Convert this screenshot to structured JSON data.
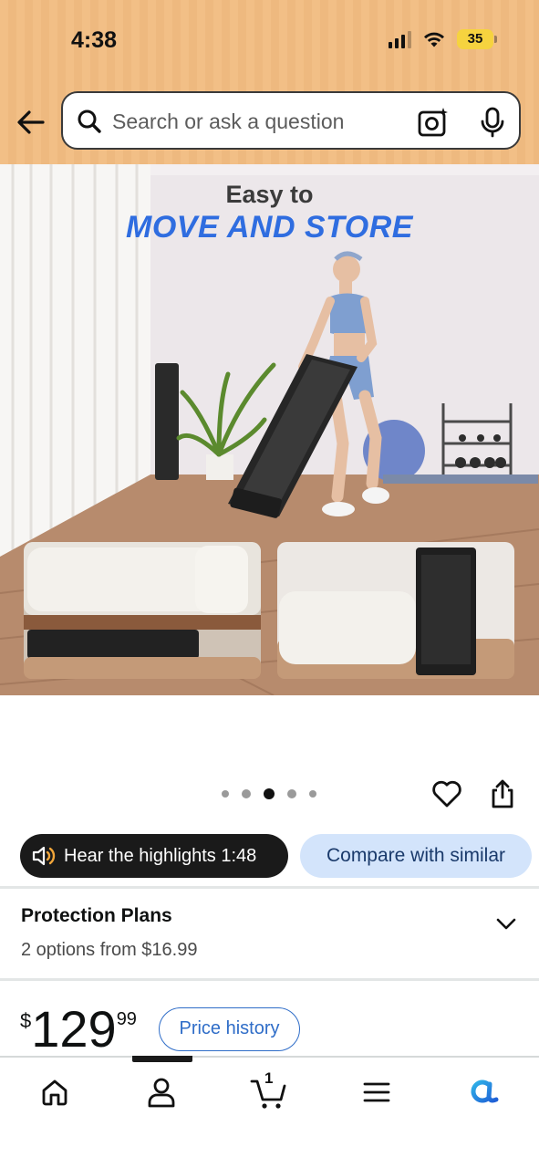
{
  "status_bar": {
    "time": "4:38",
    "battery": "35"
  },
  "search": {
    "placeholder": "Search or ask a question"
  },
  "product_image": {
    "headline_1": "Easy to",
    "headline_2": "MOVE AND STORE"
  },
  "carousel": {
    "dot_count": 5,
    "active_index": 2
  },
  "actions": {
    "hear_highlights": "Hear the highlights 1:48",
    "compare": "Compare with similar"
  },
  "protection": {
    "title": "Protection Plans",
    "subtitle": "2 options from $16.99"
  },
  "price": {
    "symbol": "$",
    "whole": "129",
    "fraction": "99",
    "history_label": "Price history"
  },
  "bottom_nav": {
    "items": [
      "home-icon",
      "account-icon",
      "cart-icon",
      "menu-icon",
      "rufus-icon"
    ],
    "cart_count": "1",
    "active": "account-icon"
  },
  "colors": {
    "header_bg": "#f2bf86",
    "accent_blue": "#2f6de0",
    "compare_bg": "#d3e4fb",
    "link_blue": "#2f6dc8"
  }
}
